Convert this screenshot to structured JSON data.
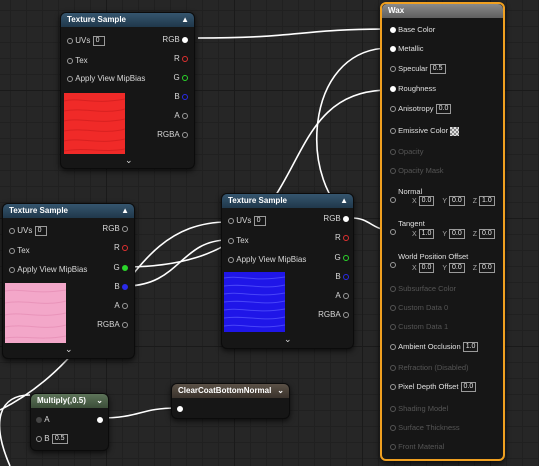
{
  "tex1": {
    "title": "Texture Sample",
    "inputs": [
      {
        "label": "UVs",
        "value": "0"
      },
      {
        "label": "Tex"
      },
      {
        "label": "Apply View MipBias"
      }
    ],
    "outputs": [
      "RGB",
      "R",
      "G",
      "B",
      "A",
      "RGBA"
    ],
    "preview_color": "#f02a28"
  },
  "tex2": {
    "title": "Texture Sample",
    "inputs": [
      {
        "label": "UVs",
        "value": "0"
      },
      {
        "label": "Tex"
      },
      {
        "label": "Apply View MipBias"
      }
    ],
    "outputs": [
      "RGB",
      "R",
      "G",
      "B",
      "A",
      "RGBA"
    ],
    "preview_color": "#f3a7c9"
  },
  "tex3": {
    "title": "Texture Sample",
    "inputs": [
      {
        "label": "UVs",
        "value": "0"
      },
      {
        "label": "Tex"
      },
      {
        "label": "Apply View MipBias"
      }
    ],
    "outputs": [
      "RGB",
      "R",
      "G",
      "B",
      "A",
      "RGBA"
    ],
    "preview_color": "#1f16e8"
  },
  "multiply": {
    "title": "Multiply(,0.5)",
    "a_label": "A",
    "b_label": "B",
    "b_value": "0.5"
  },
  "clearcoat": {
    "title": "ClearCoatBottomNormal"
  },
  "wax": {
    "title": "Wax",
    "base_color": "Base Color",
    "metallic": "Metallic",
    "specular": "Specular",
    "specular_value": "0.5",
    "roughness": "Roughness",
    "anisotropy": "Anisotropy",
    "anisotropy_value": "0.0",
    "emissive": "Emissive Color",
    "opacity": "Opacity",
    "opacity_mask": "Opacity Mask",
    "normal": "Normal",
    "normal_xyz": [
      "0.0",
      "0.0",
      "1.0"
    ],
    "tangent": "Tangent",
    "tangent_xyz": [
      "1.0",
      "0.0",
      "0.0"
    ],
    "wpo": "World Position Offset",
    "wpo_xyz": [
      "0.0",
      "0.0",
      "0.0"
    ],
    "subsurface": "Subsurface Color",
    "custom0": "Custom Data 0",
    "custom1": "Custom Data 1",
    "ao": "Ambient Occlusion",
    "ao_value": "1.0",
    "refraction": "Refraction (Disabled)",
    "pdo": "Pixel Depth Offset",
    "pdo_value": "0.0",
    "shading_model": "Shading Model",
    "surface_thickness": "Surface Thickness",
    "front_material": "Front Material",
    "axes": [
      "X",
      "Y",
      "Z"
    ]
  },
  "colors": {
    "selection": "#f0a020",
    "pin_red": "#e03030",
    "pin_green": "#2bd52b",
    "pin_blue": "#2a2ae8",
    "wire": "#ffffff"
  }
}
